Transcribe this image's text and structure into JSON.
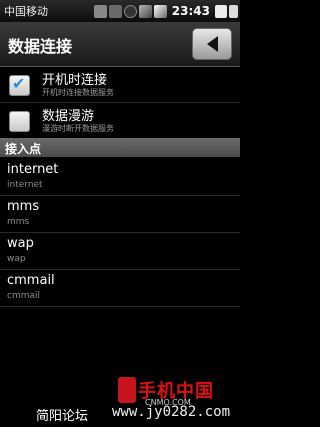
{
  "status": {
    "carrier": "中国移动",
    "time": "23:43"
  },
  "header": {
    "title": "数据连接"
  },
  "settings": [
    {
      "title": "开机时连接",
      "subtitle": "开机时连接数据服务",
      "checked": true
    },
    {
      "title": "数据漫游",
      "subtitle": "漫游时断开数据服务",
      "checked": false
    }
  ],
  "section_label": "接入点",
  "apns": [
    {
      "name": "internet",
      "apn": "internet"
    },
    {
      "name": "mms",
      "apn": "mms"
    },
    {
      "name": "wap",
      "apn": "wap"
    },
    {
      "name": "cmmail",
      "apn": "cmmail"
    }
  ],
  "watermark": {
    "logo": "手机中国",
    "logo_sub": "CNMO.COM",
    "left": "简阳论坛",
    "right": "www.jy0282.com"
  },
  "colors": {
    "checkbox_mark": "#2a8fd8",
    "logo_red": "#d11111"
  }
}
